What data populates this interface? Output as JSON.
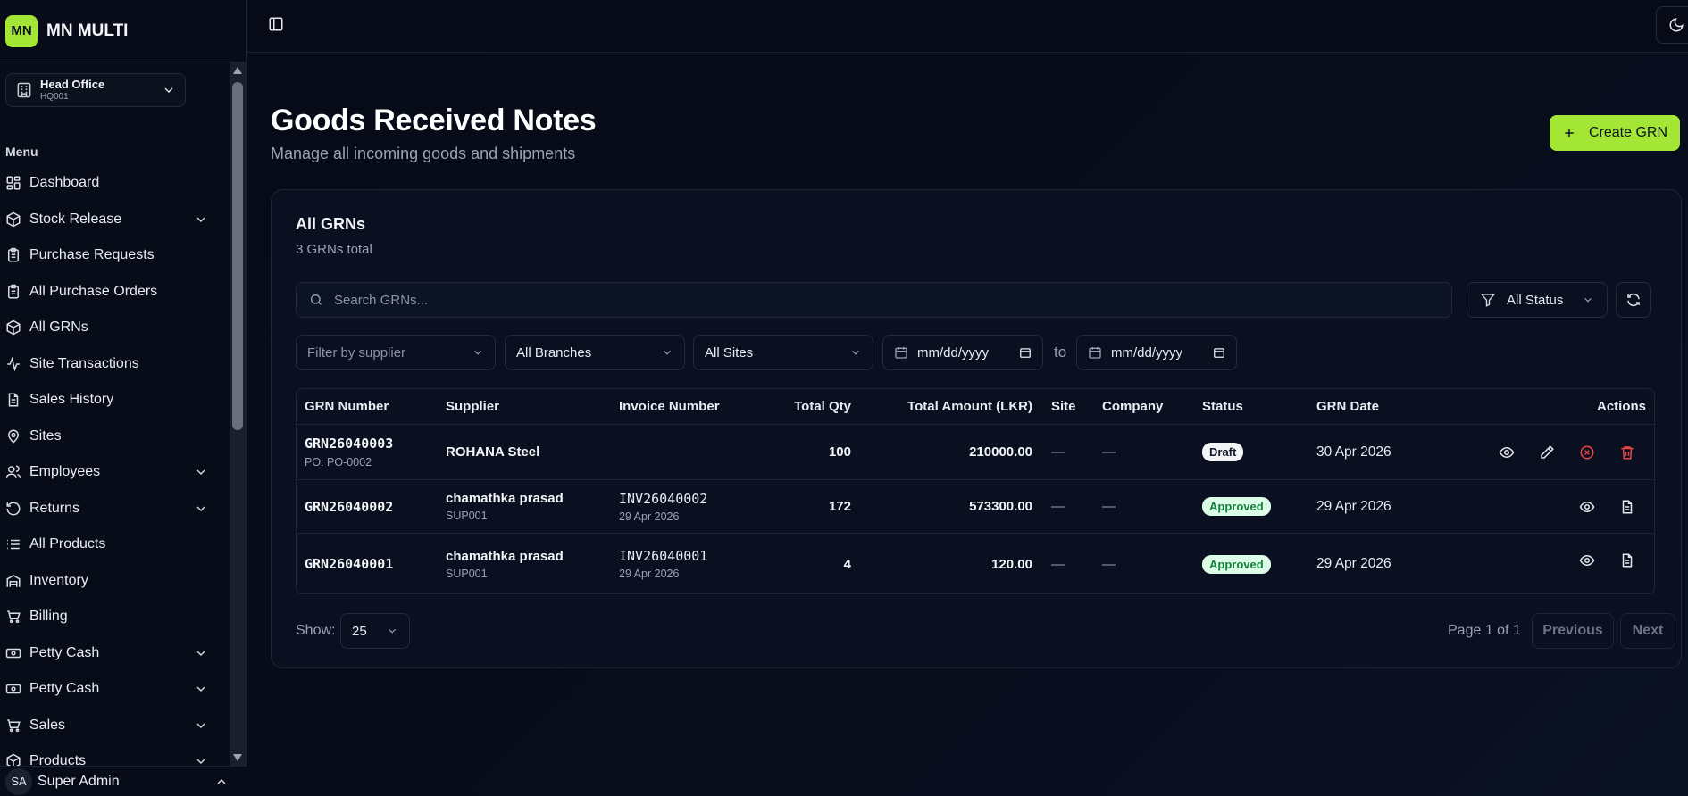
{
  "brand": {
    "logo": "MN",
    "name": "MN MULTI"
  },
  "branch": {
    "name": "Head Office",
    "code": "HQ001",
    "icon": "building-icon"
  },
  "menu_heading": "Menu",
  "menu": [
    {
      "label": "Dashboard",
      "icon": "dashboard-icon",
      "has_children": false
    },
    {
      "label": "Stock Release",
      "icon": "box-icon",
      "has_children": true
    },
    {
      "label": "Purchase Requests",
      "icon": "clipboard-icon",
      "has_children": false
    },
    {
      "label": "All Purchase Orders",
      "icon": "clipboard-icon",
      "has_children": false
    },
    {
      "label": "All GRNs",
      "icon": "box-icon",
      "has_children": false
    },
    {
      "label": "Site Transactions",
      "icon": "activity-icon",
      "has_children": false
    },
    {
      "label": "Sales History",
      "icon": "document-icon",
      "has_children": false
    },
    {
      "label": "Sites",
      "icon": "map-pin-icon",
      "has_children": false
    },
    {
      "label": "Employees",
      "icon": "users-icon",
      "has_children": true
    },
    {
      "label": "Returns",
      "icon": "rotate-ccw-icon",
      "has_children": true
    },
    {
      "label": "All Products",
      "icon": "list-icon",
      "has_children": false
    },
    {
      "label": "Inventory",
      "icon": "warehouse-icon",
      "has_children": false
    },
    {
      "label": "Billing",
      "icon": "cart-icon",
      "has_children": false
    },
    {
      "label": "Petty Cash",
      "icon": "banknote-icon",
      "has_children": true
    },
    {
      "label": "Petty Cash",
      "icon": "banknote-icon",
      "has_children": true
    },
    {
      "label": "Sales",
      "icon": "cart-icon",
      "has_children": true
    },
    {
      "label": "Products",
      "icon": "box-icon",
      "has_children": true
    }
  ],
  "user": {
    "initials": "SA",
    "name": "Super Admin"
  },
  "page": {
    "title": "Goods Received Notes",
    "subtitle": "Manage all incoming goods and shipments",
    "create_label": "Create GRN"
  },
  "card": {
    "title": "All GRNs",
    "subtitle": "3 GRNs total",
    "search_placeholder": "Search GRNs...",
    "status_filter": "All Status"
  },
  "filters": {
    "supplier_placeholder": "Filter by supplier",
    "branch": "All Branches",
    "site": "All Sites",
    "date_from": "mm/dd/yyyy",
    "to_label": "to",
    "date_to": "mm/dd/yyyy"
  },
  "table": {
    "columns": [
      "GRN Number",
      "Supplier",
      "Invoice Number",
      "Total Qty",
      "Total Amount (LKR)",
      "Site",
      "Company",
      "Status",
      "GRN Date",
      "Actions"
    ],
    "rows": [
      {
        "grn": "GRN26040003",
        "po": "PO: PO-0002",
        "supplier": "ROHANA Steel",
        "supplier_code": "",
        "invoice": "",
        "invoice_date": "",
        "qty": "100",
        "amount": "210000.00",
        "site": "—",
        "company": "—",
        "status": "Draft",
        "date": "30 Apr 2026",
        "actions": [
          "eye-icon",
          "pencil-icon",
          "x-circle-icon",
          "trash-icon"
        ]
      },
      {
        "grn": "GRN26040002",
        "po": "",
        "supplier": "chamathka prasad",
        "supplier_code": "SUP001",
        "invoice": "INV26040002",
        "invoice_date": "29 Apr 2026",
        "qty": "172",
        "amount": "573300.00",
        "site": "—",
        "company": "—",
        "status": "Approved",
        "date": "29 Apr 2026",
        "actions": [
          "eye-icon",
          "file-text-icon"
        ]
      },
      {
        "grn": "GRN26040001",
        "po": "",
        "supplier": "chamathka prasad",
        "supplier_code": "SUP001",
        "invoice": "INV26040001",
        "invoice_date": "29 Apr 2026",
        "qty": "4",
        "amount": "120.00",
        "site": "—",
        "company": "—",
        "status": "Approved",
        "date": "29 Apr 2026",
        "actions": [
          "eye-icon",
          "file-text-icon"
        ]
      }
    ]
  },
  "pagination": {
    "show_label": "Show:",
    "page_size": "25",
    "page_info": "Page 1 of 1",
    "previous": "Previous",
    "next": "Next"
  },
  "colors": {
    "accent": "#a3e635",
    "background": "#070b17",
    "danger": "#ef4444",
    "approved_bg": "#dcfce7",
    "approved_text": "#15803d"
  }
}
